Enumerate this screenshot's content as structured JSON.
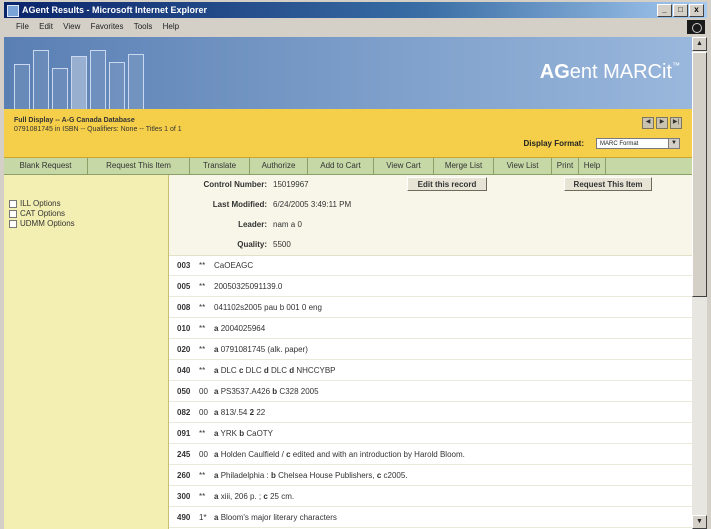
{
  "window": {
    "title": "AGent Results - Microsoft Internet Explorer"
  },
  "window_buttons": [
    "_",
    "□",
    "x"
  ],
  "menu": [
    "File",
    "Edit",
    "View",
    "Favorites",
    "Tools",
    "Help"
  ],
  "brand": {
    "prefix": "AG",
    "name": "ent MARCit",
    "tm": "™"
  },
  "info": {
    "line1": "Full Display -- A-G Canada Database",
    "line2": "0791081745 in ISBN -- Qualifiers: None -- Titles 1 of 1",
    "nav": [
      "◀",
      "▶",
      "▶|"
    ],
    "display_format_label": "Display Format:",
    "display_format_value": "MARC Format"
  },
  "toolbar": [
    "Blank Request",
    "Request This Item",
    "Translate",
    "Authorize",
    "Add to Cart",
    "View Cart",
    "Merge List",
    "View List",
    "Print",
    "Help"
  ],
  "sidebar": [
    "ILL Options",
    "CAT Options",
    "UDMM Options"
  ],
  "header": {
    "control_label": "Control Number:",
    "control_value": "15019967",
    "edit_button": "Edit this record",
    "request_button": "Request This Item",
    "modified_label": "Last Modified:",
    "modified_value": "6/24/2005 3:49:11 PM",
    "leader_label": "Leader:",
    "leader_value": "nam a 0",
    "quality_label": "Quality:",
    "quality_value": "5500"
  },
  "records": [
    {
      "tag": "003",
      "ind": "**",
      "parts": [
        [
          "",
          "CaOEAGC"
        ]
      ]
    },
    {
      "tag": "005",
      "ind": "**",
      "parts": [
        [
          "",
          "20050325091139.0"
        ]
      ]
    },
    {
      "tag": "008",
      "ind": "**",
      "parts": [
        [
          "",
          "041102s2005 pau b 001 0 eng"
        ]
      ]
    },
    {
      "tag": "010",
      "ind": "**",
      "parts": [
        [
          "a",
          "2004025964"
        ]
      ]
    },
    {
      "tag": "020",
      "ind": "**",
      "parts": [
        [
          "a",
          "0791081745 (alk. paper)"
        ]
      ]
    },
    {
      "tag": "040",
      "ind": "**",
      "parts": [
        [
          "a",
          "DLC"
        ],
        [
          "c",
          "DLC"
        ],
        [
          "d",
          "DLC"
        ],
        [
          "d",
          "NHCCYBP"
        ]
      ]
    },
    {
      "tag": "050",
      "ind": "00",
      "parts": [
        [
          "a",
          "PS3537.A426"
        ],
        [
          "b",
          "C328 2005"
        ]
      ]
    },
    {
      "tag": "082",
      "ind": "00",
      "parts": [
        [
          "a",
          "813/.54"
        ],
        [
          "2",
          "22"
        ]
      ]
    },
    {
      "tag": "091",
      "ind": "**",
      "parts": [
        [
          "a",
          "YRK"
        ],
        [
          "b",
          "CaOTY"
        ]
      ]
    },
    {
      "tag": "245",
      "ind": "00",
      "parts": [
        [
          "a",
          "Holden Caulfield /"
        ],
        [
          "c",
          "edited and with an introduction by Harold Bloom."
        ]
      ]
    },
    {
      "tag": "260",
      "ind": "**",
      "parts": [
        [
          "a",
          "Philadelphia :"
        ],
        [
          "b",
          "Chelsea House Publishers,"
        ],
        [
          "c",
          "c2005."
        ]
      ]
    },
    {
      "tag": "300",
      "ind": "**",
      "parts": [
        [
          "a",
          "xiii, 206 p. ;"
        ],
        [
          "c",
          "25 cm."
        ]
      ]
    },
    {
      "tag": "490",
      "ind": "1*",
      "parts": [
        [
          "a",
          "Bloom's major literary characters"
        ]
      ]
    }
  ]
}
